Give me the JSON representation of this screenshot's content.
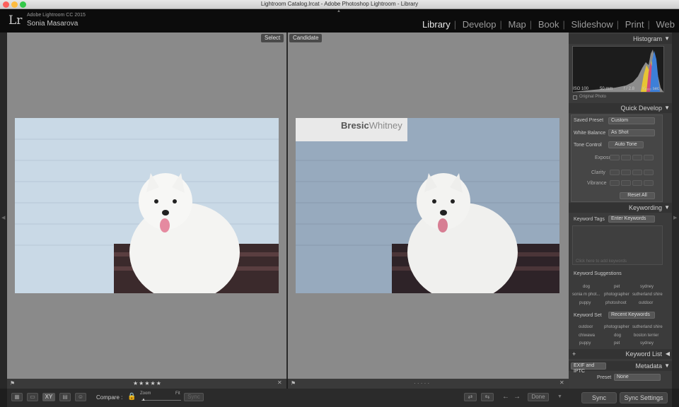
{
  "window": {
    "title": "Lightroom Catalog.lrcat - Adobe Photoshop Lightroom - Library"
  },
  "identity": {
    "product": "Adobe Lightroom CC 2015",
    "user": "Sonia Masarova",
    "logo": "Lr"
  },
  "modules": [
    "Library",
    "Develop",
    "Map",
    "Book",
    "Slideshow",
    "Print",
    "Web"
  ],
  "compare": {
    "select_label": "Select",
    "candidate_label": "Candidate",
    "left_stars": "★★★★★",
    "right_stars": "· · · · ·"
  },
  "photo": {
    "sign_text_bold": "Bresic",
    "sign_text_light": "Whitney"
  },
  "toolbar": {
    "compare_label": "Compare :",
    "zoom_label": "Zoom",
    "fit_label": "Fit",
    "sync_label": "Sync",
    "done_label": "Done",
    "xy_label": "XY"
  },
  "histogram": {
    "title": "Histogram",
    "iso": "ISO 100",
    "focal": "50 mm",
    "aperture": "f / 2.8",
    "shutter": "¹⁄₄₀₀₀ sec",
    "original_photo": "Original Photo"
  },
  "quick_develop": {
    "title": "Quick Develop",
    "saved_preset_label": "Saved Preset",
    "saved_preset_value": "Custom",
    "white_balance_label": "White Balance",
    "white_balance_value": "As Shot",
    "tone_control_label": "Tone Control",
    "auto_tone": "Auto Tone",
    "exposure": "Exposure",
    "clarity": "Clarity",
    "vibrance": "Vibrance",
    "reset_all": "Reset All"
  },
  "keywording": {
    "title": "Keywording",
    "keyword_tags_label": "Keyword Tags",
    "keyword_tags_value": "Enter Keywords",
    "add_placeholder": "Click here to add keywords",
    "suggestions_label": "Keyword Suggestions",
    "suggestions": [
      "dog",
      "pet",
      "sydney",
      "sonia m phot...",
      "photographer",
      "sutherland shire",
      "puppy",
      "photoshoot",
      "outdoor"
    ],
    "keyword_set_label": "Keyword Set",
    "keyword_set_value": "Recent Keywords",
    "set_keywords": [
      "outdoor",
      "photographer",
      "sutherland shire",
      "chiwawa",
      "dog",
      "boston terrier",
      "puppy",
      "pet",
      "sydney"
    ]
  },
  "keyword_list": {
    "title": "Keyword List",
    "plus": "+"
  },
  "metadata": {
    "title": "Metadata",
    "preset_dropdown": "EXIF and IPTC",
    "preset_label": "Preset",
    "preset_value": "None"
  },
  "sync": {
    "sync_label": "Sync",
    "sync_settings_label": "Sync Settings"
  }
}
